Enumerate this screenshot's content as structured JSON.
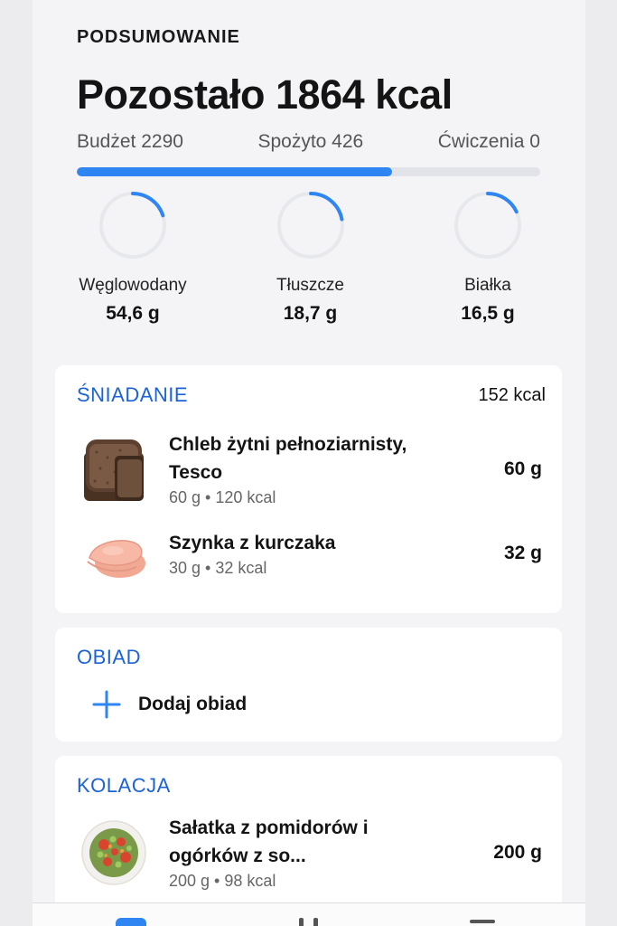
{
  "summary": {
    "label": "PODSUMOWANIE",
    "remaining": "Pozostało 1864 kcal",
    "budget": "Budżet 2290",
    "eaten": "Spożyto 426",
    "exercise": "Ćwiczenia 0",
    "progress_fraction": 0.68
  },
  "macros": [
    {
      "name": "Węglowodany",
      "value": "54,6 g",
      "progress_fraction": 0.2
    },
    {
      "name": "Tłuszcze",
      "value": "18,7 g",
      "progress_fraction": 0.22
    },
    {
      "name": "Białka",
      "value": "16,5 g",
      "progress_fraction": 0.18
    }
  ],
  "breakfast": {
    "title": "ŚNIADANIE",
    "kcal": "152 kcal",
    "items": [
      {
        "name_line1": "Chleb żytni pełnoziarnisty,",
        "name_line2": "Tesco",
        "details": "60 g • 120 kcal",
        "amount": "60 g",
        "icon": "rye-bread-icon"
      },
      {
        "name_line1": "Szynka z kurczaka",
        "details": "30 g • 32 kcal",
        "amount": "32 g",
        "icon": "chicken-ham-icon"
      }
    ]
  },
  "lunch": {
    "title": "OBIAD",
    "add_label": "Dodaj obiad"
  },
  "dinner": {
    "title": "KOLACJA",
    "items": [
      {
        "name_line1": "Sałatka z pomidorów i",
        "name_line2": "ogórków z so...",
        "details": "200 g • 98 kcal",
        "amount": "200 g",
        "icon": "tomato-cucumber-salad-icon"
      }
    ]
  },
  "colors": {
    "accent": "#2f86f3",
    "meal_title": "#1c63d6",
    "track": "#e1e3e8"
  }
}
